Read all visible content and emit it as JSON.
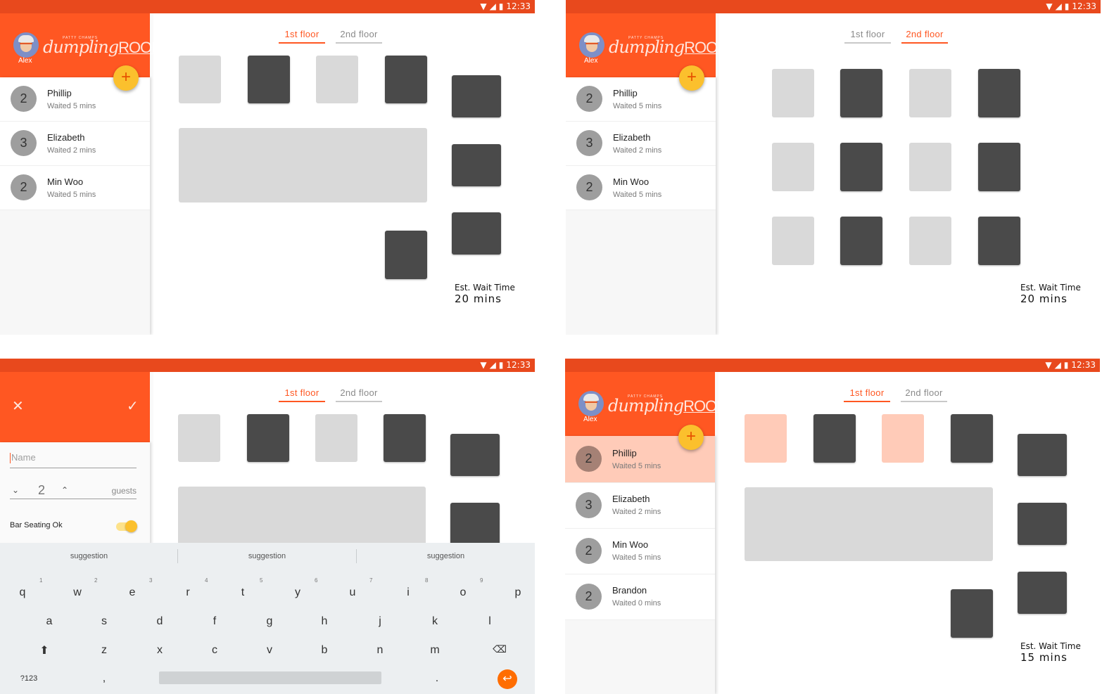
{
  "status_bar": {
    "time": "12:33"
  },
  "user": {
    "name": "Alex"
  },
  "brand": {
    "prefix": "PATTY CHAMPS",
    "word": "dumpling",
    "room": "ROOM"
  },
  "fab": "+",
  "tabs": [
    "1st floor",
    "2nd floor"
  ],
  "queue": [
    {
      "count": "2",
      "name": "Phillip",
      "waited": "Waited 5 mins"
    },
    {
      "count": "3",
      "name": "Elizabeth",
      "waited": "Waited 2 mins"
    },
    {
      "count": "2",
      "name": "Min Woo",
      "waited": "Waited 5 mins"
    },
    {
      "count": "2",
      "name": "Brandon",
      "waited": "Waited 0 mins"
    }
  ],
  "wait": {
    "label": "Est. Wait Time",
    "v20": "20 mins",
    "v15": "15 mins"
  },
  "form": {
    "close": "✕",
    "confirm": "✓",
    "name_placeholder": "Name",
    "guests_value": "2",
    "guests_label": "guests",
    "bar_seating": "Bar Seating Ok",
    "bar_seating_on": true
  },
  "keyboard": {
    "suggestions": [
      "suggestion",
      "suggestion",
      "suggestion"
    ],
    "row1": [
      "q",
      "w",
      "e",
      "r",
      "t",
      "y",
      "u",
      "i",
      "o",
      "p"
    ],
    "row1_hints": [
      "1",
      "2",
      "3",
      "4",
      "5",
      "6",
      "7",
      "8",
      "9",
      "0"
    ],
    "row2": [
      "a",
      "s",
      "d",
      "f",
      "g",
      "h",
      "j",
      "k",
      "l"
    ],
    "row3": [
      "z",
      "x",
      "c",
      "v",
      "b",
      "n",
      "m"
    ],
    "symbols": "?123",
    "comma": ",",
    "period": "."
  },
  "colors": {
    "accent": "#ff5722",
    "statusbar": "#e8491d",
    "fab": "#fbc02d",
    "table_dark": "#4a4a4a",
    "table_light": "#d9d9d9",
    "highlight": "#ffcbb8"
  }
}
